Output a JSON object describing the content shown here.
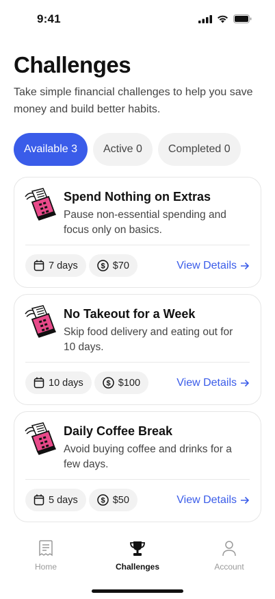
{
  "status": {
    "time": "9:41"
  },
  "header": {
    "title": "Challenges",
    "subtitle": "Take simple financial challenges to help you save money and build better habits."
  },
  "tabs": [
    {
      "label": "Available 3",
      "active": true
    },
    {
      "label": "Active 0",
      "active": false
    },
    {
      "label": "Completed 0",
      "active": false
    }
  ],
  "challenges": [
    {
      "title": "Spend Nothing on Extras",
      "description": "Pause non-essential spending and focus only on basics.",
      "duration": "7 days",
      "reward": "$70",
      "action": "View Details"
    },
    {
      "title": "No Takeout for a Week",
      "description": "Skip food delivery and eating out for 10 days.",
      "duration": "10 days",
      "reward": "$100",
      "action": "View Details"
    },
    {
      "title": "Daily Coffee Break",
      "description": "Avoid buying coffee and drinks for a few days.",
      "duration": "5 days",
      "reward": "$50",
      "action": "View Details"
    }
  ],
  "nav": {
    "home": "Home",
    "challenges": "Challenges",
    "account": "Account"
  },
  "colors": {
    "accent": "#3a5ce9",
    "illustration_pink": "#e84a8a"
  }
}
